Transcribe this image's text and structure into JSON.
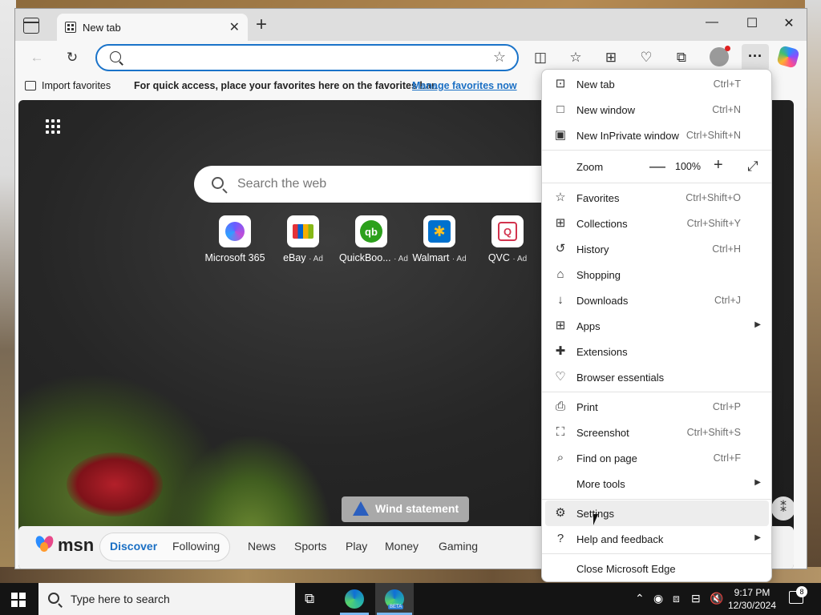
{
  "tabs": [
    {
      "title": "New tab"
    }
  ],
  "toolbar": {
    "search_placeholder": ""
  },
  "favorites_bar": {
    "import_label": "Import favorites",
    "quick_access_text": "For quick access, place your favorites here on the favorites bar.",
    "manage_link": "Manage favorites now"
  },
  "newtab": {
    "search_placeholder": "Search the web",
    "quick_links": [
      {
        "label": "Microsoft 365",
        "ad": ""
      },
      {
        "label": "eBay",
        "ad": "· Ad"
      },
      {
        "label": "QuickBoo...",
        "ad": "· Ad"
      },
      {
        "label": "Walmart",
        "ad": "· Ad"
      },
      {
        "label": "QVC",
        "ad": "· Ad"
      }
    ],
    "wind_statement": "Wind statement",
    "msn": {
      "logo_text": "msn",
      "tabs": [
        "Discover",
        "Following"
      ],
      "nav": [
        "News",
        "Sports",
        "Play",
        "Money",
        "Gaming"
      ]
    }
  },
  "menu": {
    "new_tab": {
      "label": "New tab",
      "shortcut": "Ctrl+T"
    },
    "new_window": {
      "label": "New window",
      "shortcut": "Ctrl+N"
    },
    "new_inprivate": {
      "label": "New InPrivate window",
      "shortcut": "Ctrl+Shift+N"
    },
    "zoom": {
      "label": "Zoom",
      "value": "100%",
      "minus": "—",
      "plus": "+"
    },
    "favorites": {
      "label": "Favorites",
      "shortcut": "Ctrl+Shift+O"
    },
    "collections": {
      "label": "Collections",
      "shortcut": "Ctrl+Shift+Y"
    },
    "history": {
      "label": "History",
      "shortcut": "Ctrl+H"
    },
    "shopping": {
      "label": "Shopping"
    },
    "downloads": {
      "label": "Downloads",
      "shortcut": "Ctrl+J"
    },
    "apps": {
      "label": "Apps"
    },
    "extensions": {
      "label": "Extensions"
    },
    "browser_essentials": {
      "label": "Browser essentials"
    },
    "print": {
      "label": "Print",
      "shortcut": "Ctrl+P"
    },
    "screenshot": {
      "label": "Screenshot",
      "shortcut": "Ctrl+Shift+S"
    },
    "find_on_page": {
      "label": "Find on page",
      "shortcut": "Ctrl+F"
    },
    "more_tools": {
      "label": "More tools"
    },
    "settings": {
      "label": "Settings"
    },
    "help_feedback": {
      "label": "Help and feedback"
    },
    "close_edge": {
      "label": "Close Microsoft Edge"
    }
  },
  "taskbar": {
    "search_placeholder": "Type here to search",
    "time": "9:17 PM",
    "date": "12/30/2024",
    "notification_count": "8",
    "beta_tag": "BETA"
  },
  "colors": {
    "accent": "#1a6fc4",
    "address_border": "#1a73c9",
    "taskbar": "#141414"
  }
}
